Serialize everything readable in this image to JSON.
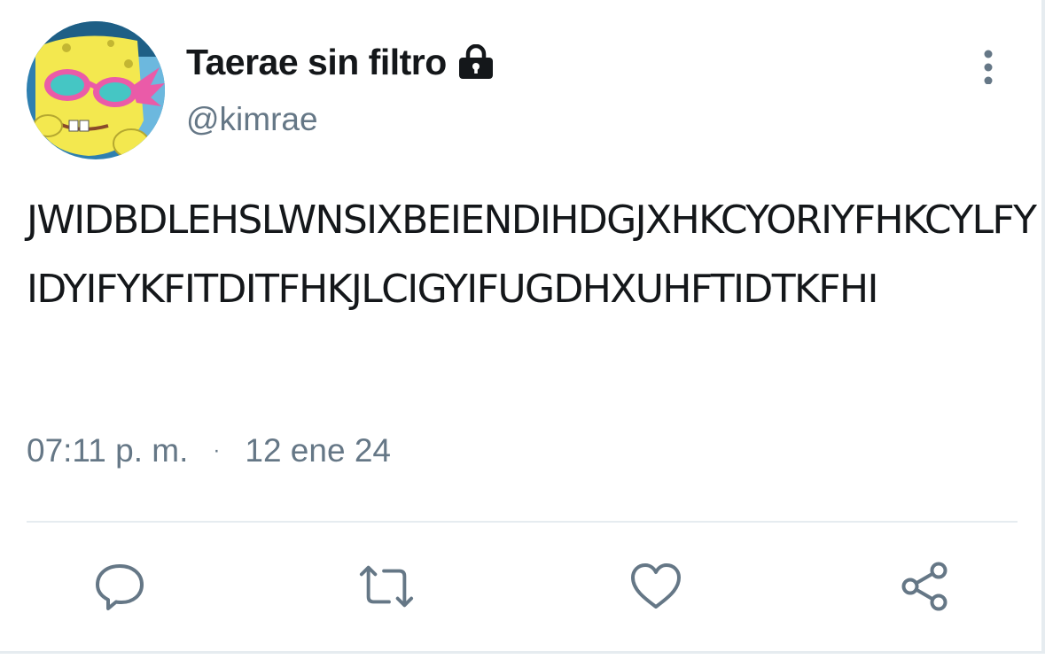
{
  "tweet": {
    "display_name": "Taerae sin filtro",
    "handle": "@kimrae",
    "text": "JWIDBDLEHSLWNSIXBEIENDIHDGJXHKCYORIYFHKCYLFYIDYIFYKFITDITFHKJLCIGYIFUGDHXUHFTIDTKFHI",
    "time": "07:11 p. m.",
    "separator": "·",
    "date": "12 ene 24"
  },
  "icons": {
    "lock": "lock-icon",
    "more": "more-vertical-icon",
    "reply": "reply-icon",
    "retweet": "retweet-icon",
    "like": "heart-icon",
    "share": "share-icon"
  },
  "colors": {
    "text_primary": "#14171a",
    "text_secondary": "#657786",
    "divider": "#e6ecf0"
  }
}
